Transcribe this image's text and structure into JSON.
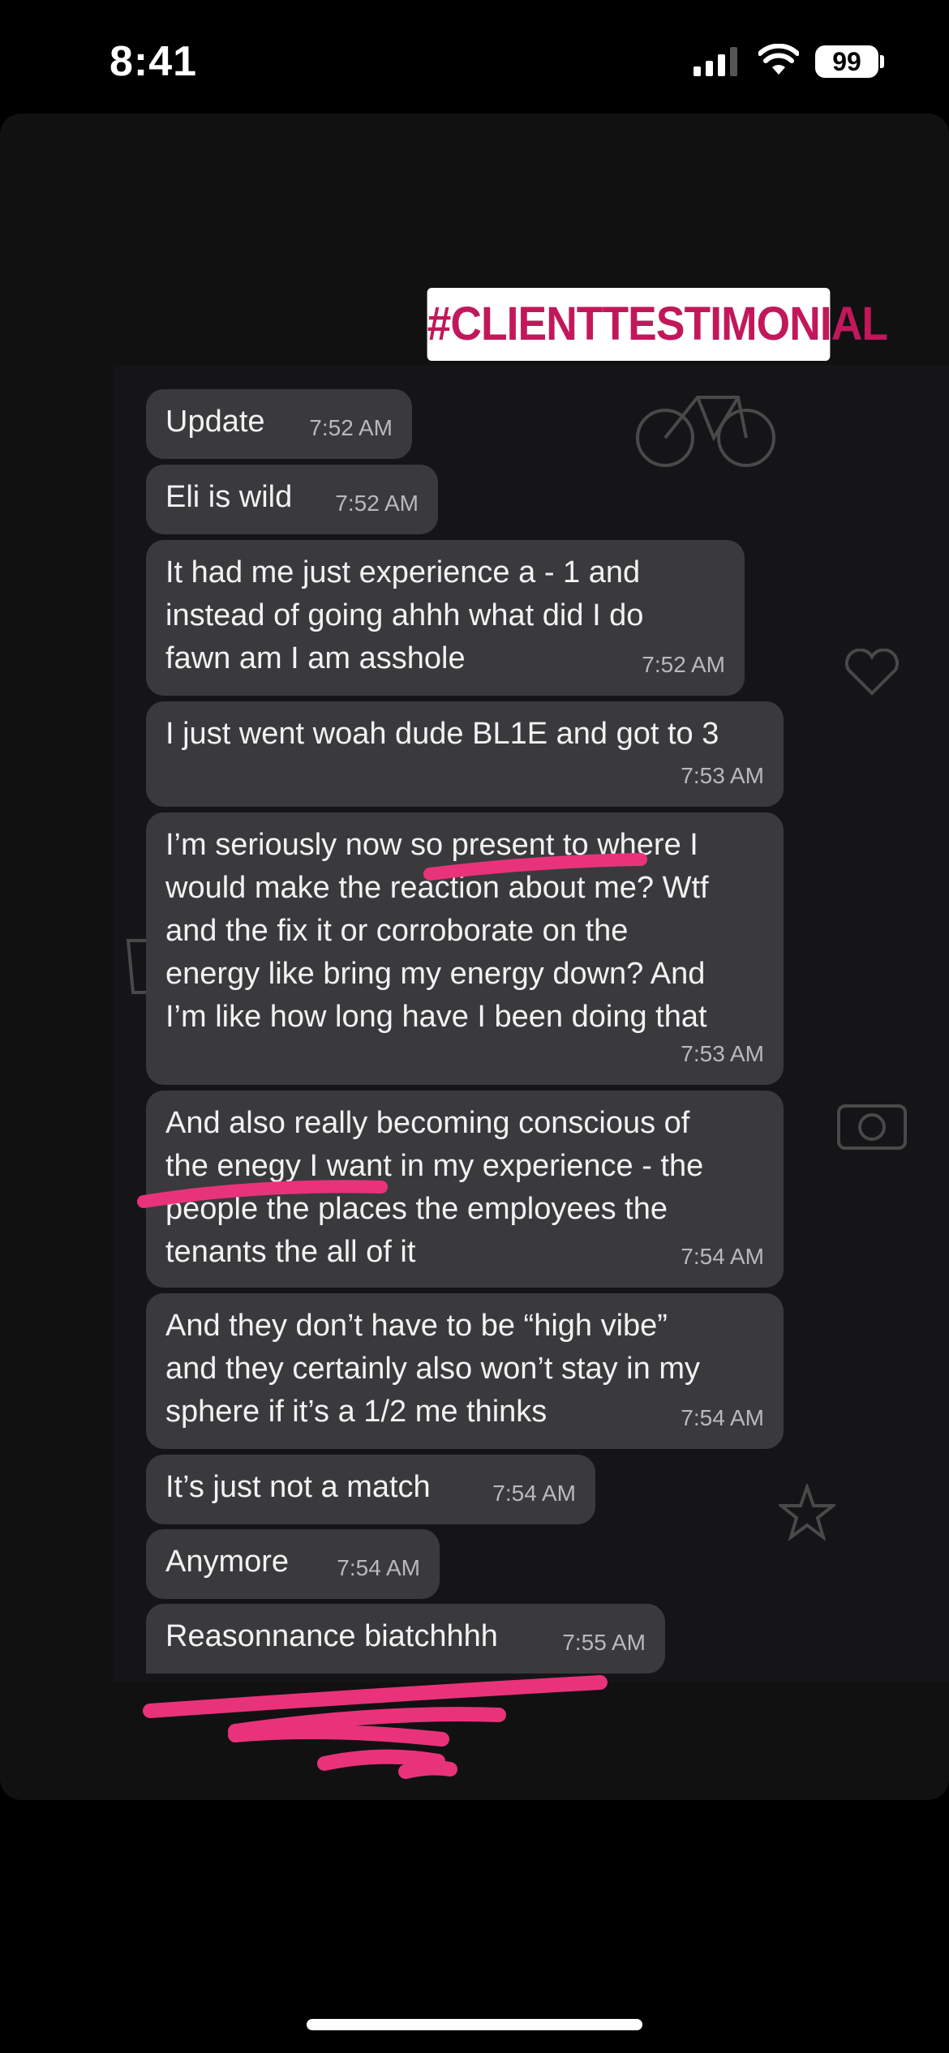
{
  "status_bar": {
    "time": "8:41",
    "battery": "99"
  },
  "story": {
    "hashtag": "#CLIENTTESTIMONIAL",
    "annotation_color": "#e8337a"
  },
  "messages": [
    {
      "text": "Update",
      "time": "7:52 AM"
    },
    {
      "text": "Eli is wild",
      "time": "7:52 AM"
    },
    {
      "text": "It had me just experience a - 1 and\ninstead of going ahhh what did I do\nfawn am I am asshole",
      "time": "7:52 AM"
    },
    {
      "text": "I just went woah dude BL1E and got to 3",
      "time": "7:53 AM"
    },
    {
      "text": "I’m seriously now so present to where I\nwould make the reaction about me? Wtf\nand the fix it or corroborate on the\nenergy like bring my energy down? And\nI’m like how long have I been doing that",
      "time": "7:53 AM"
    },
    {
      "text": "And also really becoming conscious of\nthe enegy I want in my experience - the\npeople the places the employees the\ntenants the all of it",
      "time": "7:54 AM"
    },
    {
      "text": "And they don’t have to be “high vibe”\nand they certainly also won’t stay in my\nsphere if it’s a 1/2 me thinks",
      "time": "7:54 AM"
    },
    {
      "text": "It’s just not a match",
      "time": "7:54 AM"
    },
    {
      "text": "Anymore",
      "time": "7:54 AM"
    },
    {
      "text": "Reasonnance biatchhhh",
      "time": "7:55 AM"
    }
  ]
}
